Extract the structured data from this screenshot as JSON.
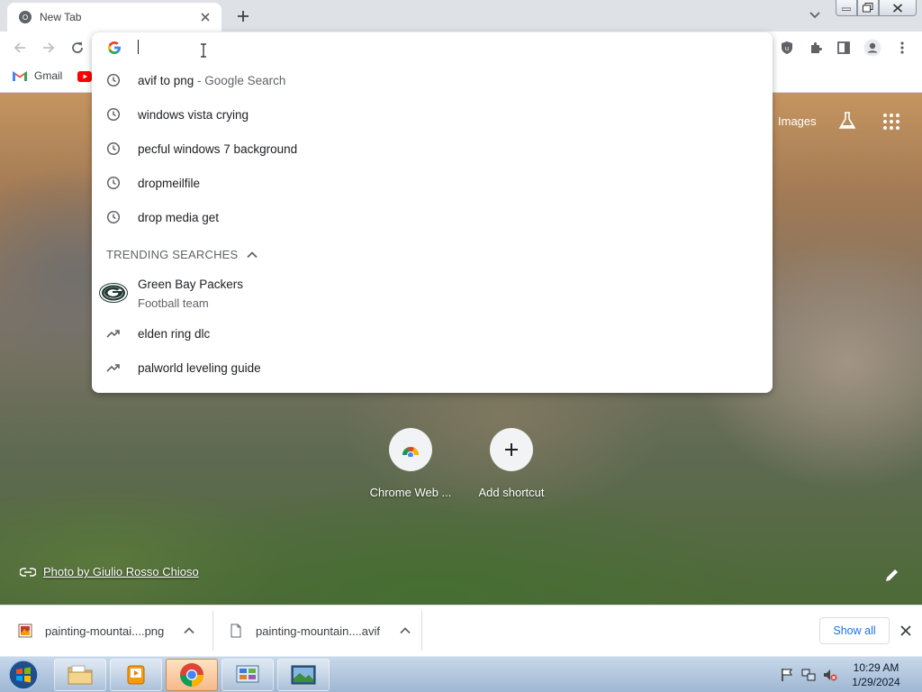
{
  "tab": {
    "title": "New Tab"
  },
  "bookmarks": [
    {
      "label": "Gmail"
    }
  ],
  "omnibox": {
    "value": "",
    "suggestions": [
      {
        "text": "avif to png",
        "suffix": " - Google Search",
        "icon": "history-clock-icon"
      },
      {
        "text": "windows vista crying",
        "icon": "history-clock-icon"
      },
      {
        "text": "pecful windows 7 background",
        "icon": "history-clock-icon"
      },
      {
        "text": "dropmeilfile",
        "icon": "history-clock-icon"
      },
      {
        "text": "drop media get",
        "icon": "history-clock-icon"
      }
    ],
    "trending_header": "TRENDING SEARCHES",
    "trending": [
      {
        "title": "Green Bay Packers",
        "subtitle": "Football team",
        "icon": "green-bay-packers-logo"
      },
      {
        "text": "elden ring dlc",
        "icon": "trending-arrow-icon"
      },
      {
        "text": "palworld leveling guide",
        "icon": "trending-arrow-icon"
      }
    ]
  },
  "ntp": {
    "images_link": "Images",
    "shortcuts": [
      {
        "label": "Chrome Web ...",
        "icon": "chrome-web-store-icon"
      },
      {
        "label": "Add shortcut",
        "icon": "plus-icon"
      }
    ],
    "attribution": "Photo by Giulio Rosso Chioso"
  },
  "downloads": {
    "items": [
      {
        "filename": "painting-mountai....png",
        "icon": "image-file-icon"
      },
      {
        "filename": "painting-mountain....avif",
        "icon": "blank-file-icon"
      }
    ],
    "show_all": "Show all"
  },
  "taskbar": {
    "time": "10:29 AM",
    "date": "1/29/2024"
  },
  "colors": {
    "accent": "#1a73e8",
    "packers_green": "#203731",
    "packers_gold": "#ffb612"
  }
}
